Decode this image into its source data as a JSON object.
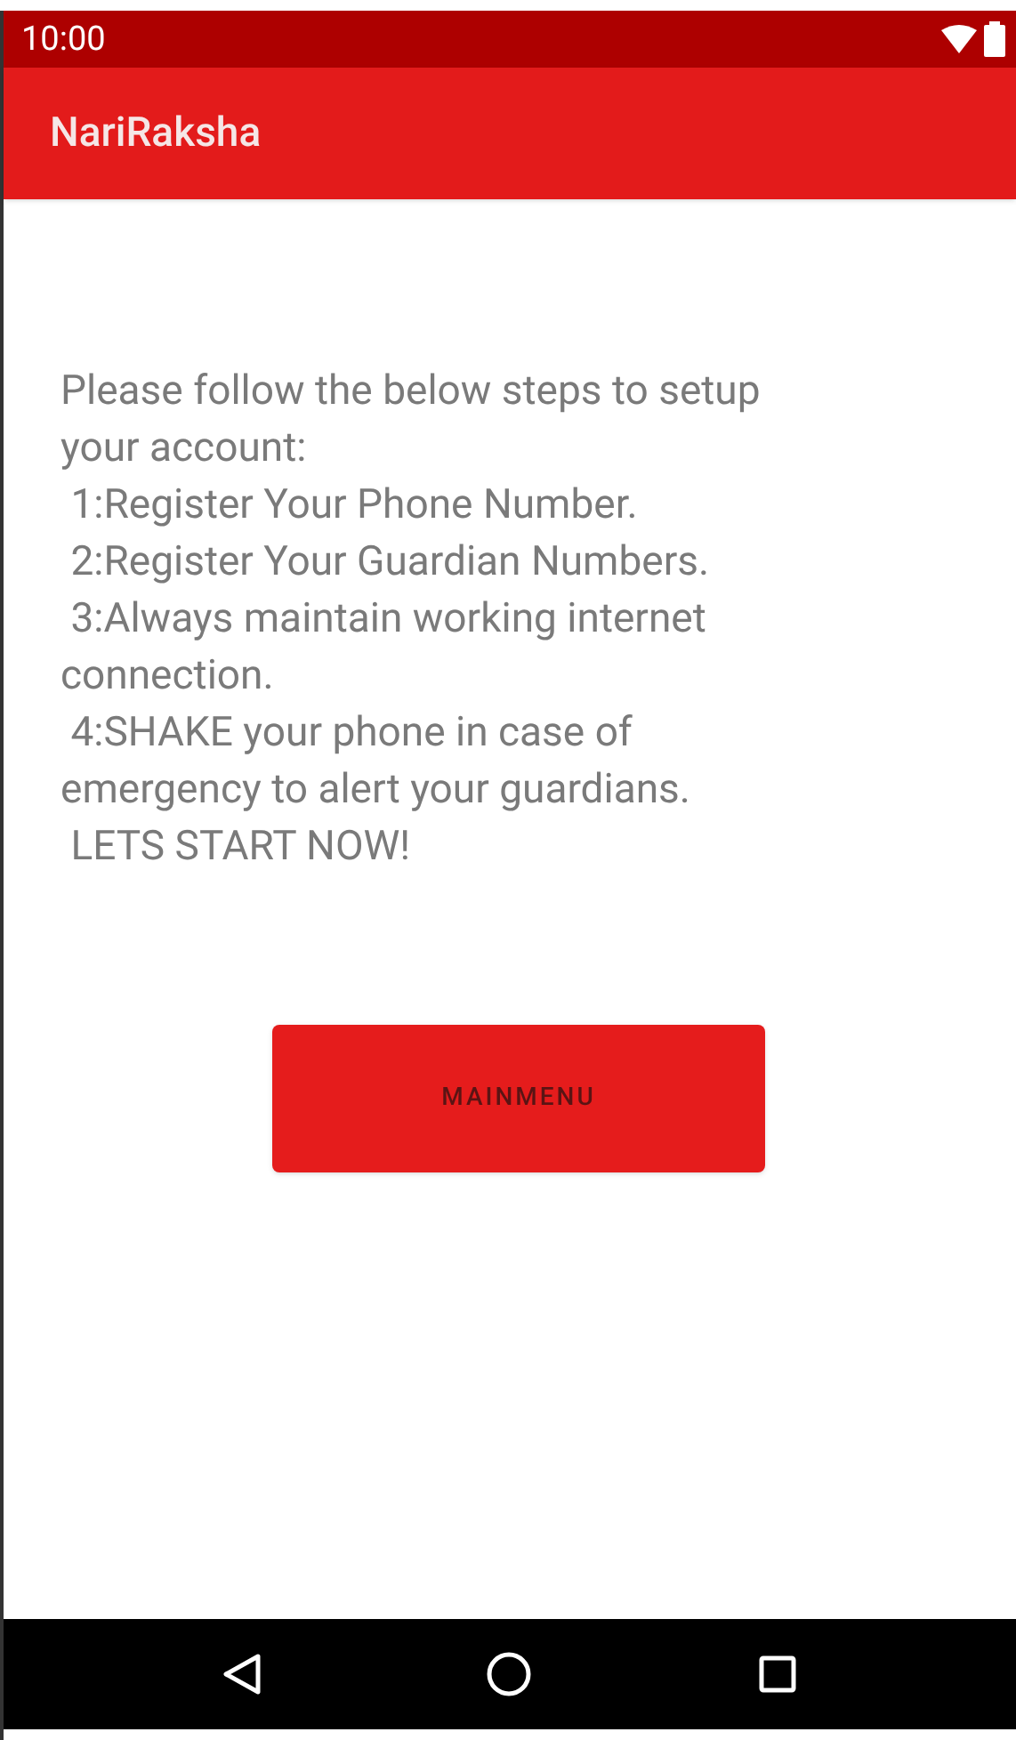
{
  "status_bar": {
    "time": "10:00"
  },
  "app_bar": {
    "title": "NariRaksha"
  },
  "instructions": "Please follow the below steps to setup\nyour account:\n 1:Register Your Phone Number.\n 2:Register Your Guardian Numbers.\n 3:Always maintain working internet\nconnection.\n 4:SHAKE your phone in case of\nemergency to alert your guardians.\n LETS START NOW!",
  "button": {
    "label": "MAINMENU"
  }
}
